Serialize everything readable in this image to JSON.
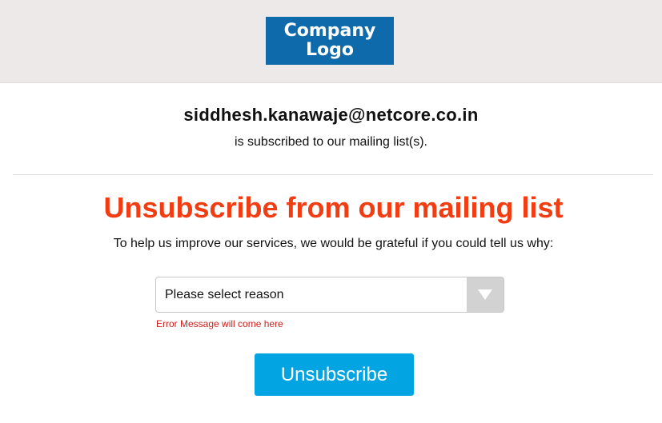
{
  "header": {
    "logo_line1": "Company",
    "logo_line2": "Logo"
  },
  "subscriber": {
    "email": "siddhesh.kanawaje@netcore.co.in",
    "status_text": "is subscribed to our mailing list(s)."
  },
  "unsubscribe": {
    "title": "Unsubscribe from our mailing list",
    "help_text": "To help us improve our services, we would be grateful if you could tell us why:",
    "reason_select": {
      "value": "Please select reason",
      "arrow_icon": "triangle-down-icon"
    },
    "error_message": "Error Message will come here",
    "button_label": "Unsubscribe"
  },
  "colors": {
    "header_bg": "#eee9e9",
    "logo_bg": "#0e6aab",
    "title": "#f23c12",
    "error": "#c8241f",
    "button_bg": "#03a4e2"
  }
}
